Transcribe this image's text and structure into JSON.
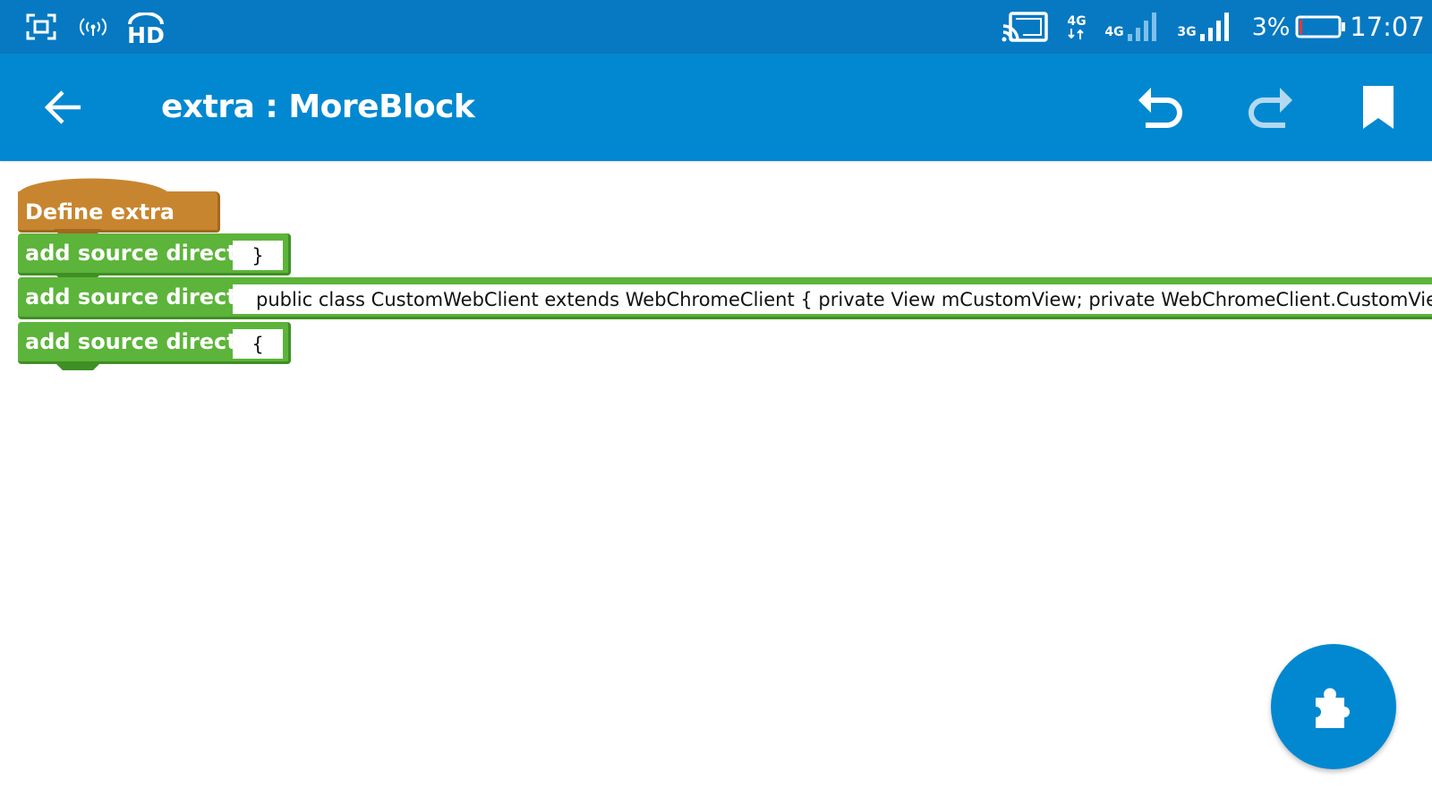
{
  "status_bar": {
    "network_4g_top": "4G",
    "network_4g": "4G",
    "network_3g": "3G",
    "battery": "3%",
    "time": "17:07",
    "hd": "HD"
  },
  "app_bar": {
    "title": "extra : MoreBlock"
  },
  "blocks": {
    "define_label": "Define extra",
    "items": [
      {
        "label": "add source directly",
        "value": "}"
      },
      {
        "label": "add source directly",
        "value": "public class CustomWebClient extends WebChromeClient { private View mCustomView; private WebChromeClient.CustomViewCallback mCustomViewCallback;"
      },
      {
        "label": "add source directly",
        "value": "{"
      }
    ]
  },
  "colors": {
    "status_bar": "#0679c2",
    "app_bar": "#0288d1",
    "define_block": "#c8852f",
    "source_block": "#5cb43a",
    "fab": "#0288d1"
  },
  "icons": {
    "screenshot": "screenshot-icon",
    "hotspot": "hotspot-icon",
    "hd_voice": "hd-voice-icon",
    "cast": "cast-icon",
    "signal": "signal-icon",
    "battery": "battery-icon",
    "back": "arrow-left-icon",
    "undo": "undo-icon",
    "redo": "redo-icon",
    "bookmark": "bookmark-icon",
    "puzzle": "puzzle-icon"
  }
}
